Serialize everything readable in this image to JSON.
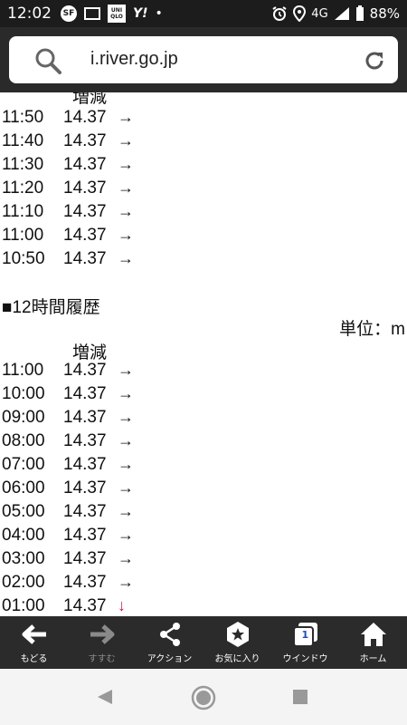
{
  "status_bar": {
    "time": "12:02",
    "network": "4G",
    "battery": "88%",
    "uniqlo_label": "UNIQLO",
    "uniqlo_lines": [
      "UNI",
      "QLO"
    ]
  },
  "browser": {
    "url": "i.river.go.jp"
  },
  "recent_table": {
    "column_header": "増減",
    "rows": [
      {
        "time": "11:50",
        "value": "14.37",
        "trend": "→"
      },
      {
        "time": "11:40",
        "value": "14.37",
        "trend": "→"
      },
      {
        "time": "11:30",
        "value": "14.37",
        "trend": "→"
      },
      {
        "time": "11:20",
        "value": "14.37",
        "trend": "→"
      },
      {
        "time": "11:10",
        "value": "14.37",
        "trend": "→"
      },
      {
        "time": "11:00",
        "value": "14.37",
        "trend": "→"
      },
      {
        "time": "10:50",
        "value": "14.37",
        "trend": "→"
      }
    ]
  },
  "history_section": {
    "title": "■12時間履歴",
    "unit": "単位：m",
    "column_header": "増減",
    "rows": [
      {
        "time": "11:00",
        "value": "14.37",
        "trend": "→"
      },
      {
        "time": "10:00",
        "value": "14.37",
        "trend": "→"
      },
      {
        "time": "09:00",
        "value": "14.37",
        "trend": "→"
      },
      {
        "time": "08:00",
        "value": "14.37",
        "trend": "→"
      },
      {
        "time": "07:00",
        "value": "14.37",
        "trend": "→"
      },
      {
        "time": "06:00",
        "value": "14.37",
        "trend": "→"
      },
      {
        "time": "05:00",
        "value": "14.37",
        "trend": "→"
      },
      {
        "time": "04:00",
        "value": "14.37",
        "trend": "→"
      },
      {
        "time": "03:00",
        "value": "14.37",
        "trend": "→"
      },
      {
        "time": "02:00",
        "value": "14.37",
        "trend": "→"
      },
      {
        "time": "01:00",
        "value": "14.37",
        "trend": "↓"
      }
    ]
  },
  "toolbar": {
    "back_label": "もどる",
    "forward_label": "すすむ",
    "action_label": "アクション",
    "favorites_label": "お気に入り",
    "window_label": "ウインドウ",
    "window_count": "1",
    "home_label": "ホーム"
  },
  "colors": {
    "down_arrow": "#c0204a",
    "toolbar_bg": "#2b2b2b",
    "status_bg": "#1c1c1c"
  }
}
